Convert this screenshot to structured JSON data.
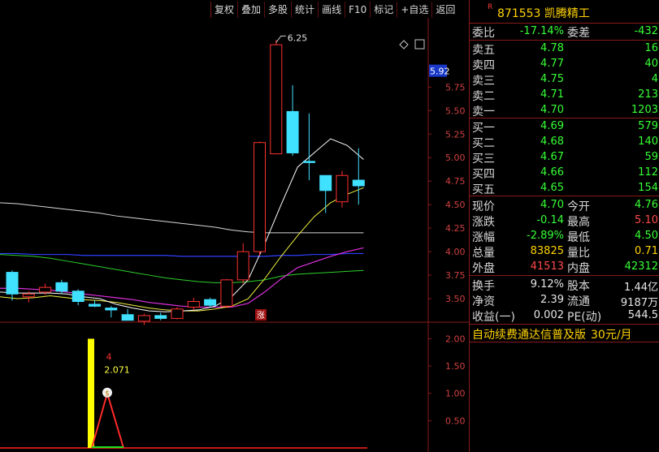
{
  "toolbar": [
    "复权",
    "叠加",
    "多股",
    "统计",
    "画线",
    "F10",
    "标记",
    "+自选",
    "返回"
  ],
  "stock": {
    "badge": "R",
    "name": "871553 凯腾精工"
  },
  "weibi": {
    "label1": "委比",
    "value1": "-17.14%",
    "label2": "委差",
    "value2": "-432"
  },
  "asks": [
    {
      "label": "卖五",
      "price": "4.78",
      "vol": "16"
    },
    {
      "label": "卖四",
      "price": "4.77",
      "vol": "40"
    },
    {
      "label": "卖三",
      "price": "4.75",
      "vol": "4"
    },
    {
      "label": "卖二",
      "price": "4.71",
      "vol": "213"
    },
    {
      "label": "卖一",
      "price": "4.70",
      "vol": "1203"
    }
  ],
  "bids": [
    {
      "label": "买一",
      "price": "4.69",
      "vol": "579"
    },
    {
      "label": "买二",
      "price": "4.68",
      "vol": "140"
    },
    {
      "label": "买三",
      "price": "4.67",
      "vol": "59"
    },
    {
      "label": "买四",
      "price": "4.66",
      "vol": "112"
    },
    {
      "label": "买五",
      "price": "4.65",
      "vol": "154"
    }
  ],
  "quote": [
    {
      "l1": "现价",
      "v1": "4.70",
      "c1": "g",
      "l2": "今开",
      "v2": "4.76",
      "c2": "g"
    },
    {
      "l1": "涨跌",
      "v1": "-0.14",
      "c1": "g",
      "l2": "最高",
      "v2": "5.10",
      "c2": "r2"
    },
    {
      "l1": "涨幅",
      "v1": "-2.89%",
      "c1": "g",
      "l2": "最低",
      "v2": "4.50",
      "c2": "g"
    },
    {
      "l1": "总量",
      "v1": "83825",
      "c1": "y",
      "l2": "量比",
      "v2": "0.71",
      "c2": "y"
    },
    {
      "l1": "外盘",
      "v1": "41513",
      "c1": "r2",
      "l2": "内盘",
      "v2": "42312",
      "c2": "g"
    }
  ],
  "fundamentals": [
    {
      "l1": "换手",
      "v1": "9.12%",
      "l2": "股本",
      "v2": "1.44亿"
    },
    {
      "l1": "净资",
      "v1": "2.39",
      "l2": "流通",
      "v2": "9187万"
    },
    {
      "l1": "收益(一)",
      "v1": "0.002",
      "l2": "PE(动)",
      "v2": "544.5"
    }
  ],
  "ad": {
    "text": "自动续费通达信普及版",
    "price": "30元/月"
  },
  "chart_data": {
    "type": "candlestick",
    "price_axis": {
      "ticks": [
        "5.75",
        "5.50",
        "5.25",
        "5.00",
        "4.75",
        "4.50",
        "4.25",
        "4.00",
        "3.75",
        "3.50"
      ],
      "current_label": "5.92",
      "ylim": [
        3.25,
        6.4
      ]
    },
    "high_label": "6.25",
    "rise_marker": "涨",
    "candles": [
      {
        "o": 3.78,
        "h": 3.8,
        "l": 3.48,
        "c": 3.55
      },
      {
        "o": 3.52,
        "h": 3.58,
        "l": 3.46,
        "c": 3.55
      },
      {
        "o": 3.57,
        "h": 3.66,
        "l": 3.54,
        "c": 3.62
      },
      {
        "o": 3.67,
        "h": 3.7,
        "l": 3.55,
        "c": 3.58
      },
      {
        "o": 3.58,
        "h": 3.6,
        "l": 3.43,
        "c": 3.47
      },
      {
        "o": 3.44,
        "h": 3.48,
        "l": 3.41,
        "c": 3.42
      },
      {
        "o": 3.4,
        "h": 3.42,
        "l": 3.3,
        "c": 3.38
      },
      {
        "o": 3.33,
        "h": 3.39,
        "l": 3.29,
        "c": 3.27
      },
      {
        "o": 3.26,
        "h": 3.34,
        "l": 3.22,
        "c": 3.32
      },
      {
        "o": 3.32,
        "h": 3.35,
        "l": 3.27,
        "c": 3.29
      },
      {
        "o": 3.29,
        "h": 3.41,
        "l": 3.28,
        "c": 3.39
      },
      {
        "o": 3.41,
        "h": 3.51,
        "l": 3.38,
        "c": 3.47
      },
      {
        "o": 3.49,
        "h": 3.51,
        "l": 3.41,
        "c": 3.43
      },
      {
        "o": 3.42,
        "h": 3.71,
        "l": 3.4,
        "c": 3.7
      },
      {
        "o": 3.7,
        "h": 4.09,
        "l": 3.66,
        "c": 4.0
      },
      {
        "o": 4.0,
        "h": 5.17,
        "l": 3.96,
        "c": 5.16
      },
      {
        "o": 5.04,
        "h": 6.25,
        "l": 5.04,
        "c": 6.2
      },
      {
        "o": 5.49,
        "h": 5.77,
        "l": 5.02,
        "c": 5.05
      },
      {
        "o": 4.96,
        "h": 5.47,
        "l": 4.76,
        "c": 4.95
      },
      {
        "o": 4.81,
        "h": 4.81,
        "l": 4.41,
        "c": 4.65
      },
      {
        "o": 4.53,
        "h": 4.86,
        "l": 4.47,
        "c": 4.81
      },
      {
        "o": 4.76,
        "h": 5.1,
        "l": 4.5,
        "c": 4.7
      }
    ],
    "ma_white": [
      3.57,
      3.56,
      3.56,
      3.56,
      3.55,
      3.52,
      3.5,
      3.44,
      3.4,
      3.37,
      3.36,
      3.37,
      3.38,
      3.42,
      3.52,
      3.7,
      4.08,
      4.5,
      4.9,
      5.05,
      5.2,
      5.13,
      4.98
    ],
    "ma_yellow": [
      3.52,
      3.5,
      3.51,
      3.53,
      3.51,
      3.49,
      3.48,
      3.46,
      3.43,
      3.4,
      3.38,
      3.37,
      3.37,
      3.39,
      3.42,
      3.5,
      3.71,
      3.95,
      4.17,
      4.37,
      4.52,
      4.61,
      4.68
    ],
    "ma_magenta": [
      3.61,
      3.61,
      3.6,
      3.59,
      3.57,
      3.55,
      3.53,
      3.51,
      3.49,
      3.46,
      3.44,
      3.42,
      3.41,
      3.41,
      3.41,
      3.45,
      3.57,
      3.71,
      3.83,
      3.89,
      3.95,
      4.0,
      4.04
    ],
    "ma_green": [
      3.97,
      3.96,
      3.95,
      3.93,
      3.9,
      3.87,
      3.84,
      3.81,
      3.78,
      3.75,
      3.72,
      3.7,
      3.68,
      3.67,
      3.67,
      3.68,
      3.7,
      3.74,
      3.76,
      3.77,
      3.78,
      3.79,
      3.8
    ],
    "ma_blue": [
      3.98,
      3.98,
      3.97,
      3.97,
      3.97,
      3.96,
      3.96,
      3.96,
      3.96,
      3.96,
      3.96,
      3.95,
      3.95,
      3.95,
      3.95,
      3.95,
      3.95,
      3.96,
      3.96,
      3.97,
      3.97,
      3.98,
      3.98
    ],
    "ma_long": [
      4.52,
      4.51,
      4.49,
      4.47,
      4.45,
      4.43,
      4.41,
      4.38,
      4.36,
      4.34,
      4.32,
      4.3,
      4.28,
      4.26,
      4.23,
      4.21,
      4.2,
      4.2,
      4.2,
      4.2,
      4.2,
      4.2,
      4.2
    ],
    "indicator": {
      "ticks": [
        "2.00",
        "1.50",
        "1.00",
        "0.50"
      ],
      "ylim": [
        0,
        2.2
      ],
      "bar_value": 2.0,
      "bar_index": 5,
      "label_top": "4",
      "label_value": "2.071",
      "peak_value": 1.0
    }
  }
}
